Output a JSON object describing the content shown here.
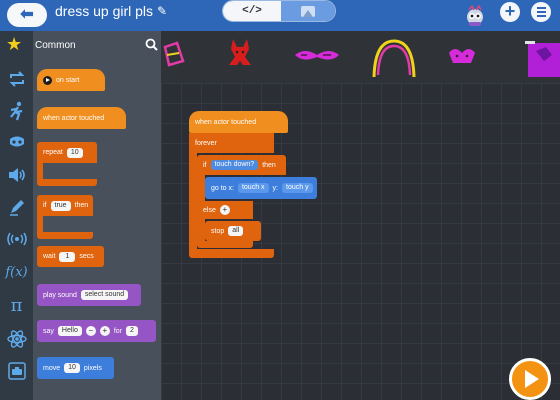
{
  "header": {
    "back_label": "⬅",
    "title": "dress up girl pls",
    "code_toggle_label": "</>",
    "add_label": "+"
  },
  "palette": {
    "title": "Common",
    "blocks": {
      "on_start": "on start",
      "when_actor_touched": "when actor touched",
      "repeat": "repeat",
      "repeat_value": "10",
      "if": "if",
      "if_value": "true",
      "then": "then",
      "wait": "wait",
      "wait_value": "1",
      "secs": "secs",
      "play_sound": "play sound",
      "sound_value": "select sound",
      "say": "say",
      "say_value": "Hello",
      "minus": "−",
      "plus": "+",
      "for": "for",
      "for_value": "2",
      "move": "move",
      "move_value": "10",
      "pixels": "pixels"
    }
  },
  "script": {
    "when_actor_touched": "when actor touched",
    "forever": "forever",
    "if": "if",
    "touch_down": "touch down?",
    "then": "then",
    "go_to": "go to x:",
    "touch_x": "touch x",
    "y": "y:",
    "touch_y": "touch y",
    "else": "else",
    "else_plus": "+",
    "stop": "stop",
    "stop_value": "all"
  },
  "colors": {
    "header": "#2e67b8",
    "event_orange": "#f08f1f",
    "control_orange": "#e0630d",
    "looks_purple": "#9555c4",
    "motion_blue": "#3d7edc",
    "rail_icon": "#5ea9ea",
    "star": "#f3cd1a"
  },
  "icons": [
    "back-arrow-icon",
    "pencil-icon",
    "code-icon",
    "scene-icon",
    "avatar-icon",
    "plus-icon",
    "menu-icon",
    "star-icon",
    "search-icon",
    "repeat-icon",
    "runner-icon",
    "costume-icon",
    "speaker-icon",
    "pen-icon",
    "broadcast-icon",
    "function-icon",
    "pi-icon",
    "atom-icon",
    "camera-icon",
    "play-icon"
  ]
}
